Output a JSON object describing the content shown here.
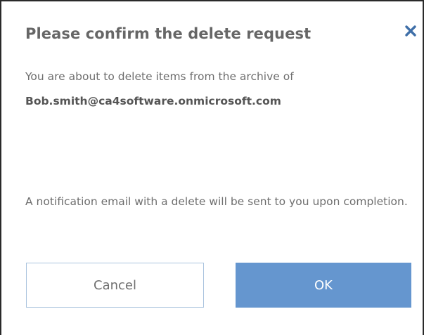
{
  "dialog": {
    "title": "Please confirm the delete request",
    "close_icon": "close-icon",
    "message": "You are about to delete items from the archive of",
    "account": "Bob.smith@ca4software.onmicrosoft.com",
    "notice": "A notification email with a delete will be sent to you upon completion.",
    "cancel_label": "Cancel",
    "ok_label": "OK"
  },
  "colors": {
    "title": "#666666",
    "close_icon": "#3f6fa8",
    "text": "#6e6e6e",
    "cancel_border": "#a9c3de",
    "ok_background": "#6596cf"
  }
}
